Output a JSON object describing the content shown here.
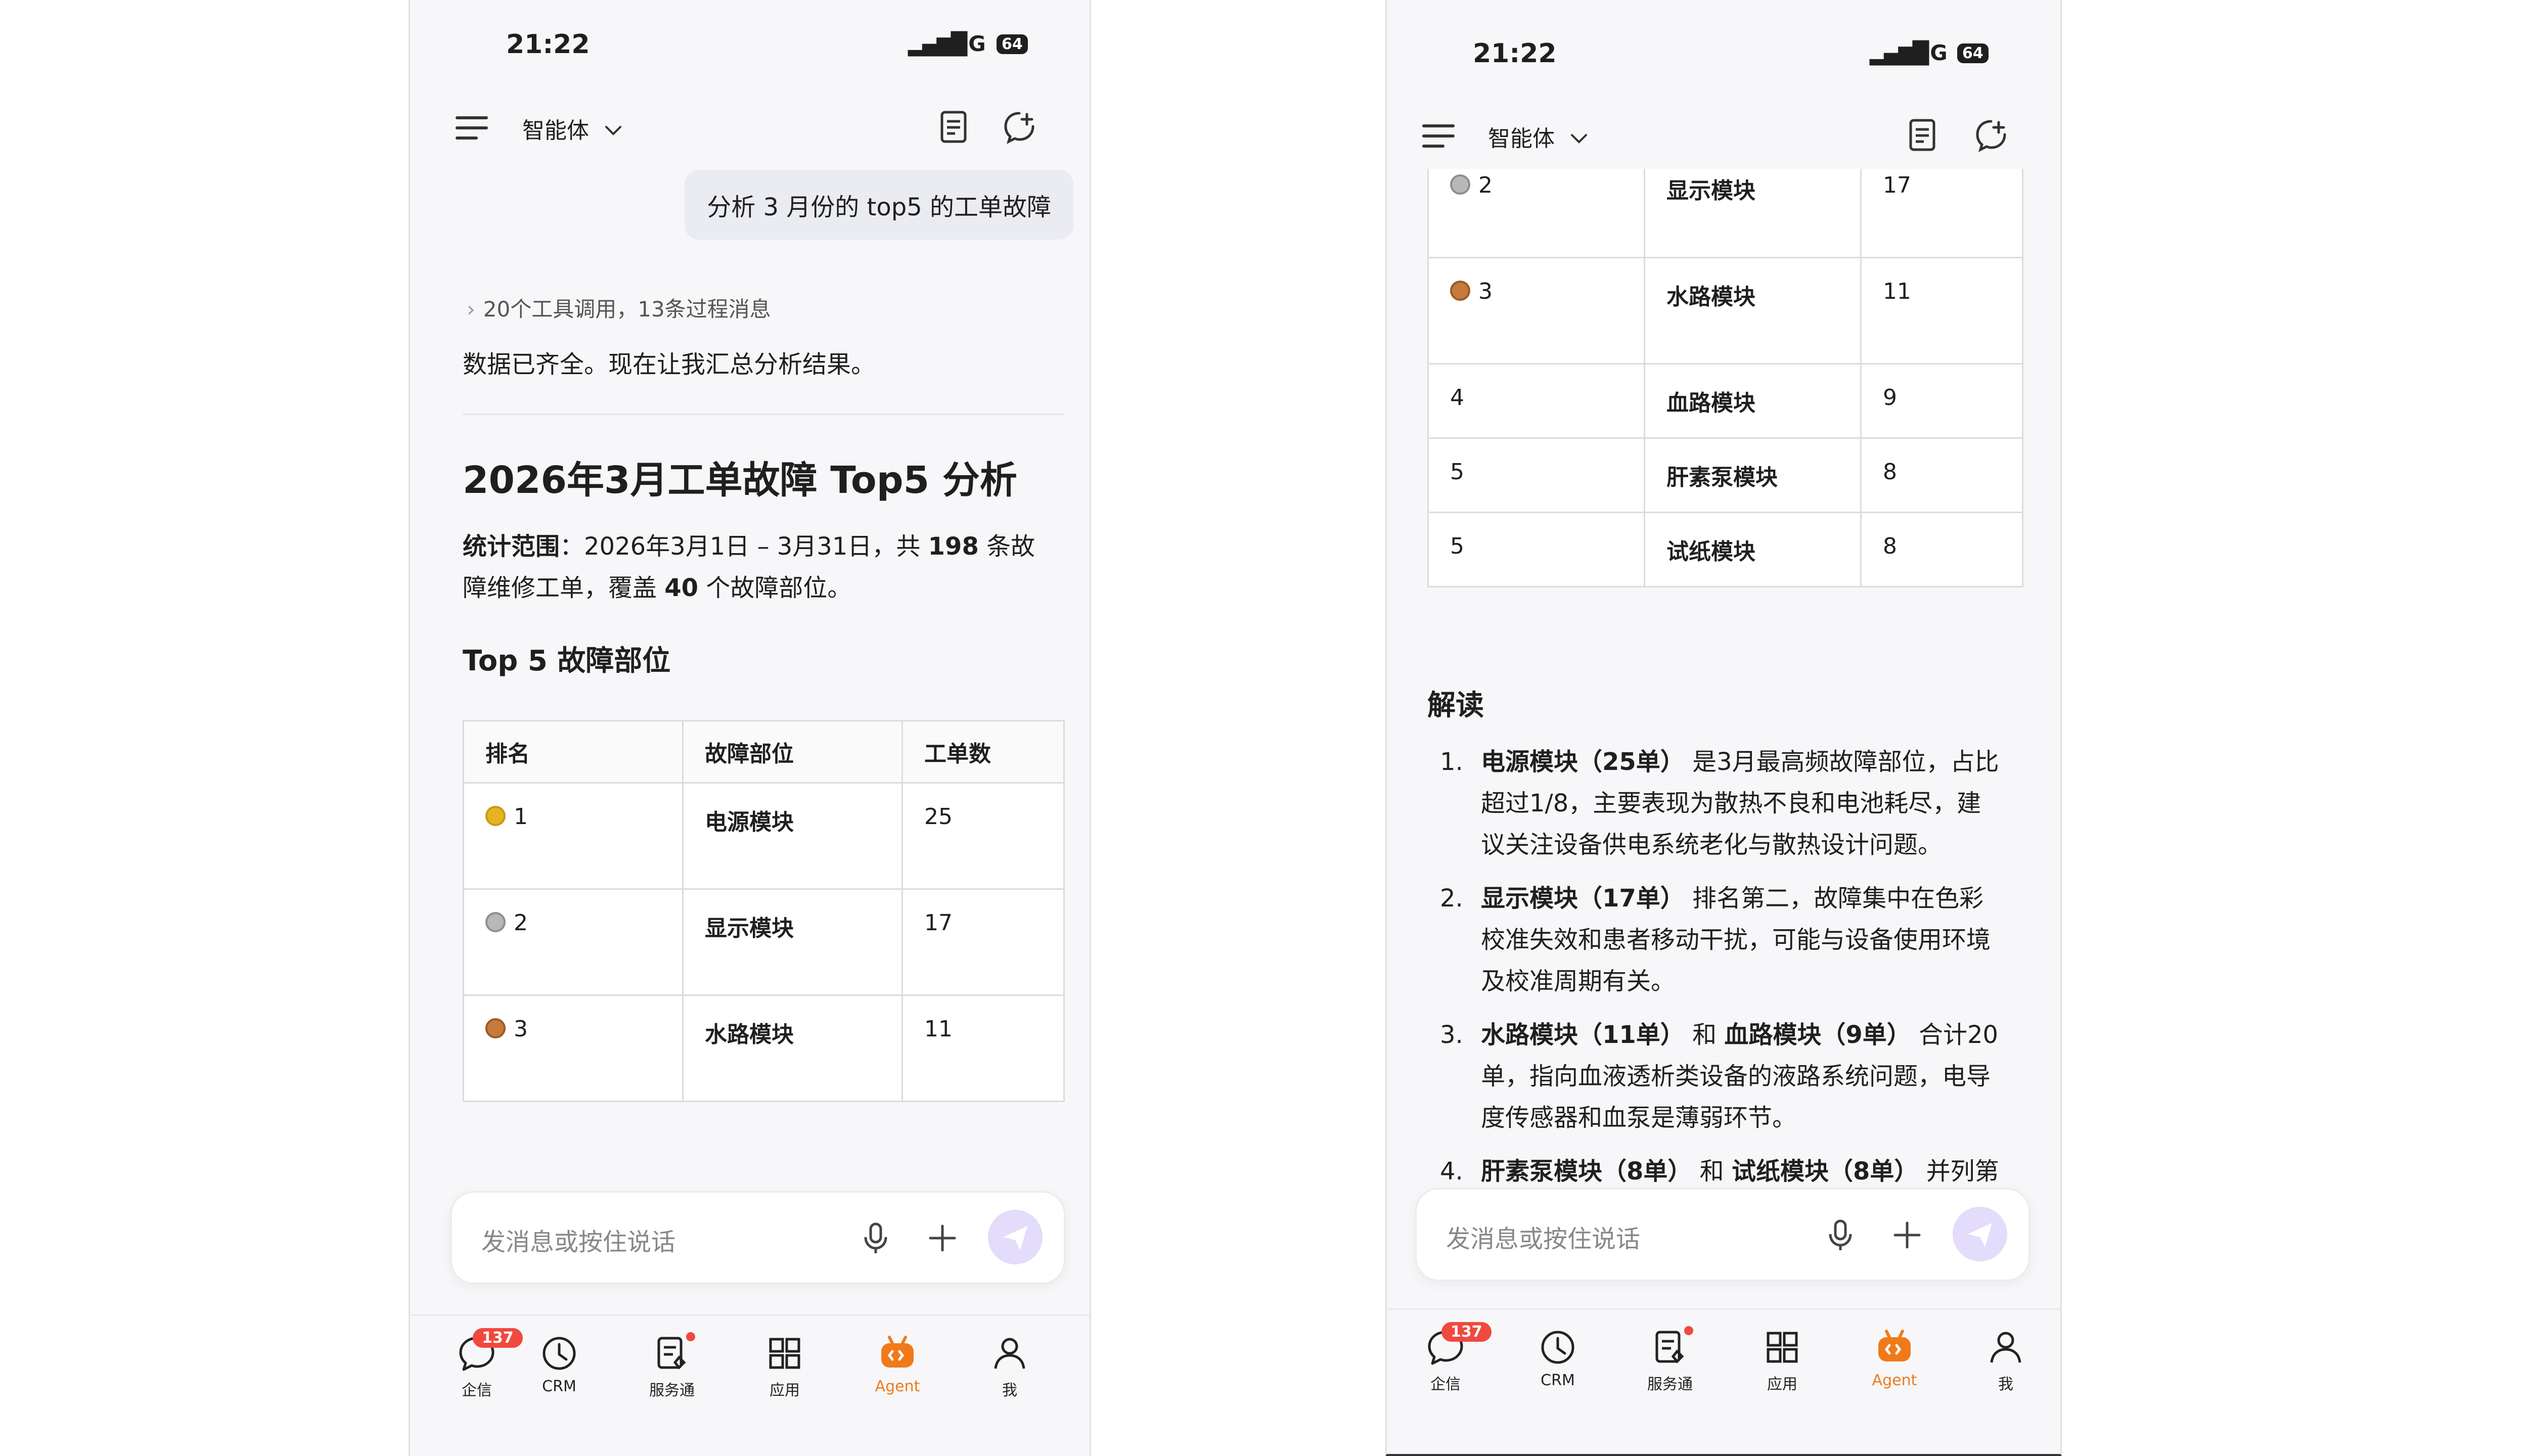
{
  "status": {
    "time": "21:22",
    "network": "5G",
    "battery": "64"
  },
  "header": {
    "agent_label": "智能体"
  },
  "user_message": "分析 3 月份的 top5 的工单故障",
  "tool_summary": "20个工具调用，13条过程消息",
  "intro": "数据已齐全。现在让我汇总分析结果。",
  "report": {
    "title": "2026年3月工单故障 Top5 分析",
    "scope_label": "统计范围",
    "scope_line1_pre": "：2026年3月1日 – 3月31日，共 ",
    "scope_count": "198",
    "scope_line1_post": " 条故",
    "scope_line2_pre": "障维修工单，覆盖 ",
    "scope_parts": "40",
    "scope_line2_post": " 个故障部位。",
    "table_heading": "Top 5 故障部位",
    "columns": [
      "排名",
      "故障部位",
      "工单数"
    ],
    "rows": [
      {
        "rank": "1",
        "medal": "gold",
        "part": "电源模块",
        "count": "25"
      },
      {
        "rank": "2",
        "medal": "silver",
        "part": "显示模块",
        "count": "17"
      },
      {
        "rank": "3",
        "medal": "bronze",
        "part": "水路模块",
        "count": "11"
      },
      {
        "rank": "4",
        "medal": "",
        "part": "血路模块",
        "count": "9"
      },
      {
        "rank": "5",
        "medal": "",
        "part": "肝素泵模块",
        "count": "8"
      },
      {
        "rank": "5",
        "medal": "",
        "part": "试纸模块",
        "count": "8"
      }
    ],
    "interpretation_heading": "解读",
    "interpretation": [
      {
        "lines": [
          [
            {
              "b": "电源模块（25单）"
            },
            {
              "t": " 是3月最高频故障部位，占比"
            }
          ],
          [
            {
              "t": "超过1/8，主要表现为散热不良和电池耗尽，建"
            }
          ],
          [
            {
              "t": "议关注设备供电系统老化与散热设计问题。"
            }
          ]
        ]
      },
      {
        "lines": [
          [
            {
              "b": "显示模块（17单）"
            },
            {
              "t": " 排名第二，故障集中在色彩"
            }
          ],
          [
            {
              "t": "校准失效和患者移动干扰，可能与设备使用环境"
            }
          ],
          [
            {
              "t": "及校准周期有关。"
            }
          ]
        ]
      },
      {
        "lines": [
          [
            {
              "b": "水路模块（11单）"
            },
            {
              "t": " 和 "
            },
            {
              "b": "血路模块（9单）"
            },
            {
              "t": " 合计20"
            }
          ],
          [
            {
              "t": "单，指向血液透析类设备的液路系统问题，电导"
            }
          ],
          [
            {
              "t": "度传感器和血泵是薄弱环节。"
            }
          ]
        ]
      },
      {
        "lines": [
          [
            {
              "b": "肝素泵模块（8单）"
            },
            {
              "t": " 和 "
            },
            {
              "b": "试纸模块（8单）"
            },
            {
              "t": " 并列第"
            }
          ]
        ]
      }
    ]
  },
  "input": {
    "placeholder": "发消息或按住说话"
  },
  "tabbar": {
    "tabs": [
      {
        "label": "企信",
        "icon": "chat-icon"
      },
      {
        "label": "CRM",
        "icon": "clock-icon"
      },
      {
        "label": "服务通",
        "icon": "service-icon"
      },
      {
        "label": "应用",
        "icon": "apps-icon"
      },
      {
        "label": "Agent",
        "icon": "agent-icon"
      },
      {
        "label": "我",
        "icon": "person-icon"
      }
    ],
    "chat_badge": "137",
    "active_tab": "Agent",
    "active_color": "#f07a1a"
  }
}
